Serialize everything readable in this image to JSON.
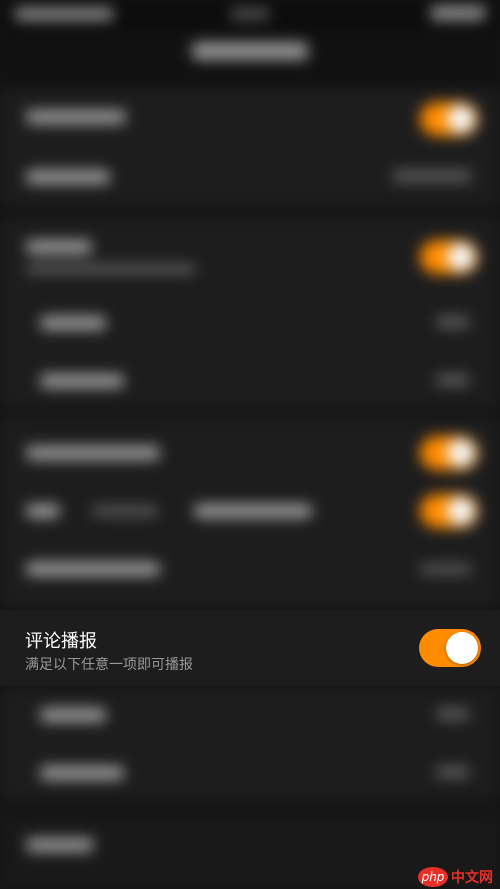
{
  "comment_broadcast": {
    "title": "评论播报",
    "subtitle": "满足以下任意一项即可播报",
    "enabled": true
  },
  "watermark": {
    "logo_text": "php",
    "site_text": "中文网"
  },
  "colors": {
    "accent": "#ff8c00",
    "row_background": "#1d1d1e",
    "title_text": "#ffffff",
    "subtitle_text": "#9a9a9a",
    "watermark": "#e8302a"
  },
  "icons": {
    "watermark_logo": "php-logo-icon"
  }
}
